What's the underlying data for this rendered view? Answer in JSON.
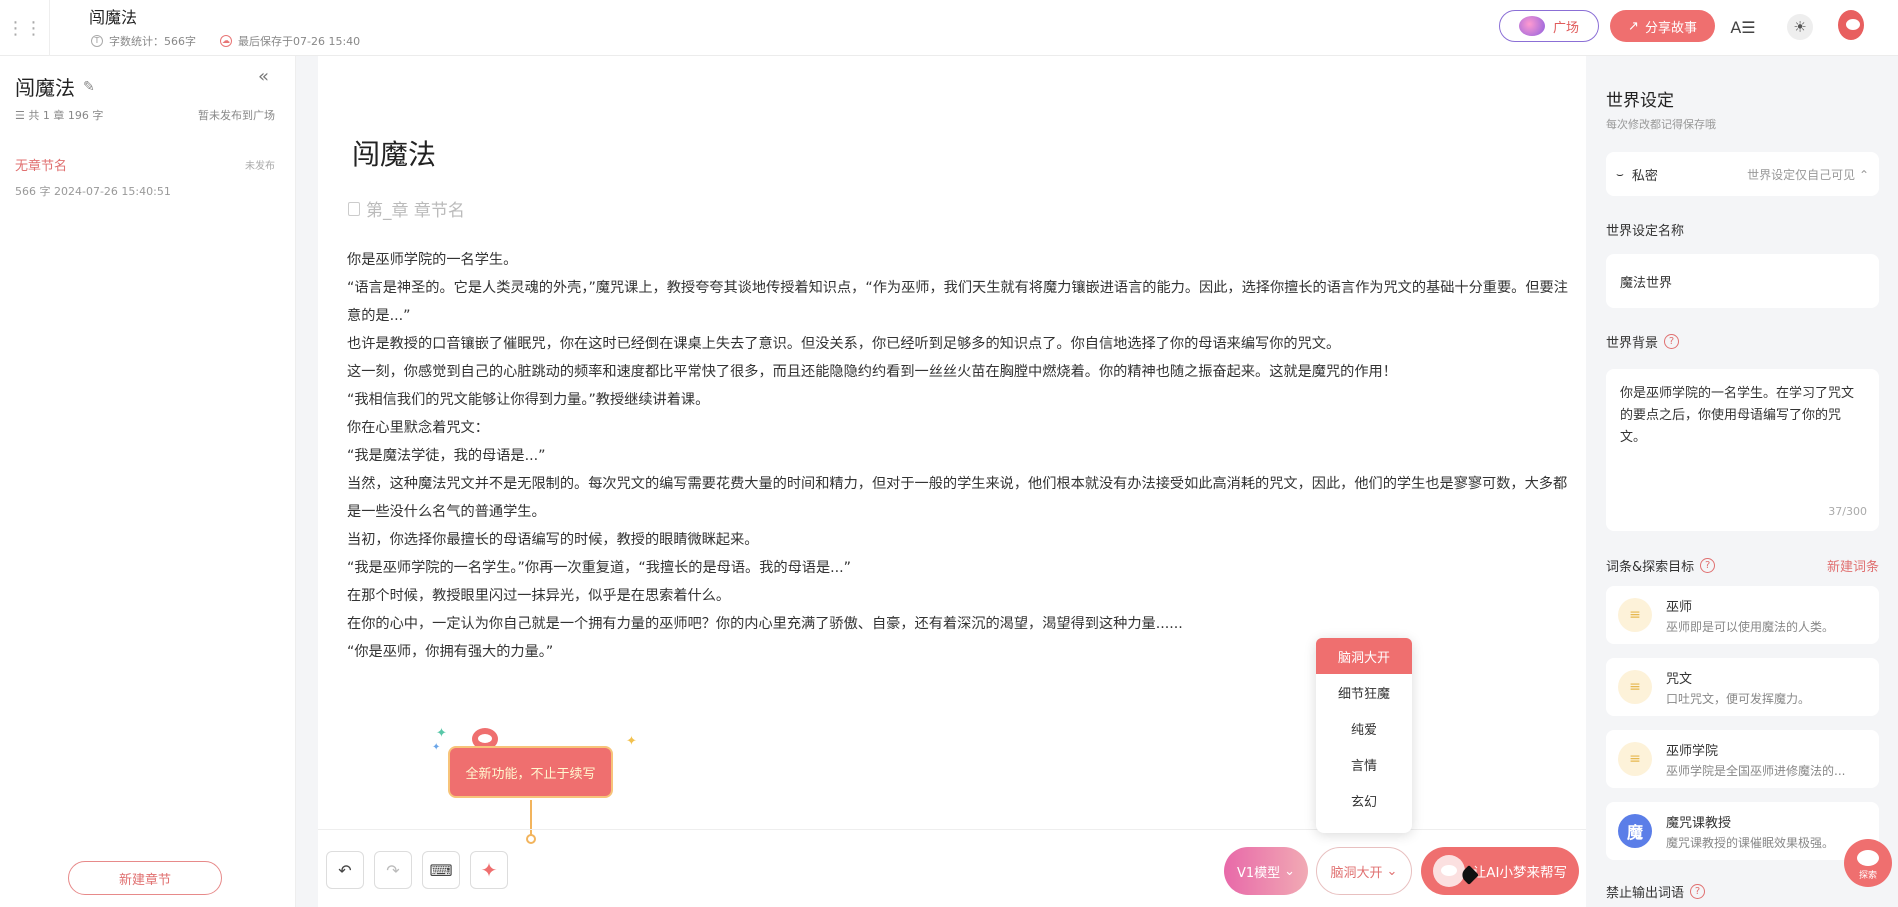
{
  "header": {
    "doc_title": "闯魔法",
    "word_count": "字数统计：566字",
    "saved": "最后保存于07-26 15:40",
    "plaza_label": "广场",
    "share_label": "分享故事",
    "font_icon": "A☰",
    "theme_icon": "☀"
  },
  "sidebar": {
    "title": "闯魔法",
    "stats": "☰ 共 1 章  196 字",
    "publish_state": "暂未发布到广场",
    "chapters": [
      {
        "name": "无章节名",
        "state": "未发布",
        "meta": "566 字  2024-07-26 15:40:51"
      }
    ],
    "new_chapter_label": "新建章节"
  },
  "editor": {
    "title": "闯魔法",
    "section_placeholder": "第_章 章节名",
    "paragraphs": [
      "你是巫师学院的一名学生。",
      "“语言是神圣的。它是人类灵魂的外壳，”魔咒课上，教授夸夸其谈地传授着知识点，“作为巫师，我们天生就有将魔力镶嵌进语言的能力。因此，选择你擅长的语言作为咒文的基础十分重要。但要注意的是...”",
      "也许是教授的口音镶嵌了催眠咒，你在这时已经倒在课桌上失去了意识。但没关系，你已经听到足够多的知识点了。你自信地选择了你的母语来编写你的咒文。",
      "这一刻，你感觉到自己的心脏跳动的频率和速度都比平常快了很多，而且还能隐隐约约看到一丝丝火苗在胸膛中燃烧着。你的精神也随之振奋起来。这就是魔咒的作用！",
      "“我相信我们的咒文能够让你得到力量。”教授继续讲着课。",
      "你在心里默念着咒文：",
      "“我是魔法学徒，我的母语是...”",
      "当然，这种魔法咒文并不是无限制的。每次咒文的编写需要花费大量的时间和精力，但对于一般的学生来说，他们根本就没有办法接受如此高消耗的咒文，因此，他们的学生也是寥寥可数，大多都是一些没什么名气的普通学生。",
      "当初，你选择你最擅长的母语编写的时候，教授的眼睛微眯起来。",
      "“我是巫师学院的一名学生。”你再一次重复道，“我擅长的是母语。我的母语是...”",
      "在那个时候，教授眼里闪过一抹异光，似乎是在思索着什么。",
      "在你的心中，一定认为你自己就是一个拥有力量的巫师吧？你的内心里充满了骄傲、自豪，还有着深沉的渴望，渴望得到这种力量......",
      "“你是巫师，你拥有强大的力量。”"
    ],
    "tip": "全新功能，不止于续写",
    "styles": [
      "脑洞大开",
      "细节狂魔",
      "纯爱",
      "言情",
      "玄幻"
    ],
    "model_label": "V1模型",
    "style_label": "脑洞大开",
    "ai_label": "让AI小梦来帮写"
  },
  "world": {
    "title": "世界设定",
    "subtitle": "每次修改都记得保存哦",
    "privacy_label": "私密",
    "privacy_desc": "世界设定仅自己可见",
    "name_label": "世界设定名称",
    "name_value": "魔法世界",
    "bg_label": "世界背景",
    "bg_value": "你是巫师学院的一名学生。在学习了咒文的要点之后，你使用母语编写了你的咒文。",
    "bg_count": "37/300",
    "words_label": "词条&探索目标",
    "new_word_label": "新建词条",
    "words": [
      {
        "name": "巫师",
        "desc": "巫师即是可以使用魔法的人类。",
        "icon": "≡"
      },
      {
        "name": "咒文",
        "desc": "口吐咒文，便可发挥魔力。",
        "icon": "≡"
      },
      {
        "name": "巫师学院",
        "desc": "巫师学院是全国巫师进修魔法的...",
        "icon": "≡"
      },
      {
        "name": "魔咒课教授",
        "desc": "魔咒课教授的课催眠效果极强。",
        "icon": "魔"
      }
    ],
    "ban_label": "禁止输出词语",
    "explore_label": "探索"
  },
  "colors": {
    "accent": "#ef6f6f",
    "plaza_border": "#8b6fd6"
  }
}
